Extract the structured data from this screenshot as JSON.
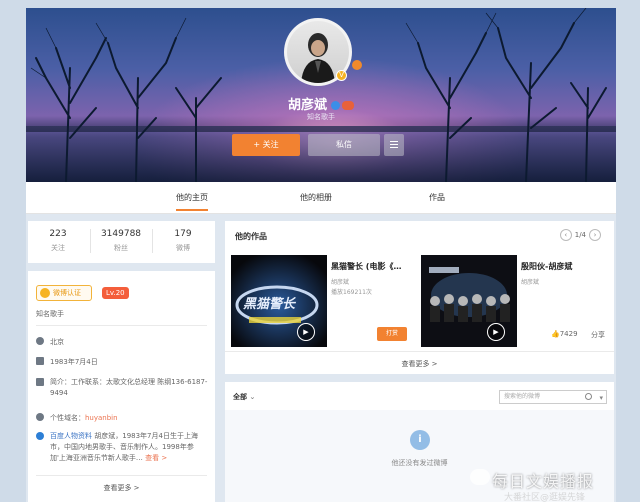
{
  "profile": {
    "name": "胡彦斌",
    "description": "知名歌手",
    "follow_label": "+ 关注",
    "message_label": "私信"
  },
  "tabs": [
    {
      "label": "他的主页",
      "active": true
    },
    {
      "label": "他的相册",
      "active": false
    },
    {
      "label": "作品",
      "active": false
    }
  ],
  "stats": [
    {
      "value": "223",
      "label": "关注"
    },
    {
      "value": "3149788",
      "label": "粉丝"
    },
    {
      "value": "179",
      "label": "微博"
    }
  ],
  "info": {
    "cert_label": "微博认证",
    "level_label": "Lv.20",
    "title": "知名歌手",
    "location": "北京",
    "birthday": "1983年7月4日",
    "bio_label": "简介：",
    "bio": "工作联系：太歌文化总经理 陈纲136-6187-9494",
    "domain_label": "个性域名：",
    "domain": "huyanbin",
    "baike_source": "百度人物资料",
    "baike_text": "胡彦斌，1983年7月4日生于上海市，中国内地男歌手、音乐制作人。1998年参加'上海亚洲音乐节新人歌手…",
    "baike_more": "查看 >",
    "see_more": "查看更多 >"
  },
  "works": {
    "title": "他的作品",
    "pager": "1/4",
    "see_more": "查看更多 >",
    "items": [
      {
        "title": "黑猫警长 (电影《…",
        "author": "胡彦斌",
        "plays": "播放169211次",
        "action": "打赏",
        "poster_text": "黑猫警长"
      },
      {
        "title": "殷阳伙-胡彦斌",
        "author": "胡彦斌",
        "likes": "7429",
        "share": "分享"
      }
    ]
  },
  "feed": {
    "filter_label": "全部",
    "search_placeholder": "搜索他的微博",
    "empty_text": "他还没有发过微博"
  },
  "watermark": {
    "line1": "每日文娱播报",
    "line2": "大番社区@逛娱先锋"
  },
  "colors": {
    "accent": "#f28231",
    "brand_link": "#eb7350",
    "page_bg": "#dfe7f0"
  }
}
